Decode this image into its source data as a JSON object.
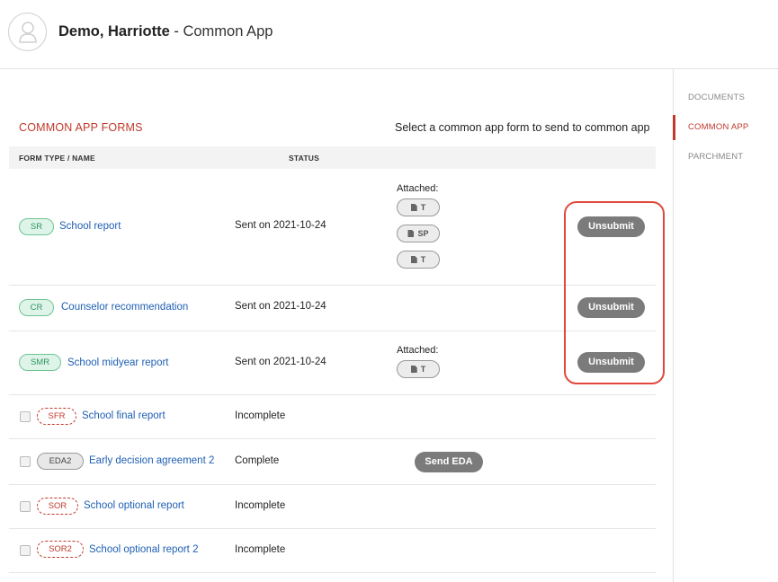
{
  "header": {
    "name": "Demo, Harriotte",
    "separator": " - ",
    "app": "Common App"
  },
  "sidebar": {
    "items": [
      {
        "label": "DOCUMENTS"
      },
      {
        "label": "COMMON APP"
      },
      {
        "label": "PARCHMENT"
      }
    ]
  },
  "section": {
    "title": "COMMON APP FORMS",
    "hint": "Select a common app form to send to common app"
  },
  "table": {
    "headers": [
      "FORM TYPE / NAME",
      "STATUS"
    ],
    "attached_label": "Attached:",
    "rows": [
      {
        "code": "SR",
        "name": "School report",
        "status": "Sent on 2021-10-24",
        "attachments": [
          "T",
          "SP",
          "T"
        ],
        "action": "Unsubmit"
      },
      {
        "code": "CR",
        "name": "Counselor recommendation",
        "status": "Sent on 2021-10-24",
        "attachments": [],
        "action": "Unsubmit"
      },
      {
        "code": "SMR",
        "name": "School midyear report",
        "status": "Sent on 2021-10-24",
        "attachments": [
          "T"
        ],
        "action": "Unsubmit"
      },
      {
        "code": "SFR",
        "name": "School final report",
        "status": "Incomplete"
      },
      {
        "code": "EDA2",
        "name": "Early decision agreement 2",
        "status": "Complete",
        "action": "Send EDA"
      },
      {
        "code": "SOR",
        "name": "School optional report",
        "status": "Incomplete"
      },
      {
        "code": "SOR2",
        "name": "School optional report 2",
        "status": "Incomplete"
      }
    ]
  },
  "colors": {
    "accent": "#c0392b",
    "link": "#1f5fb4",
    "button": "#7b7b7b",
    "highlight": "#e0473a"
  }
}
